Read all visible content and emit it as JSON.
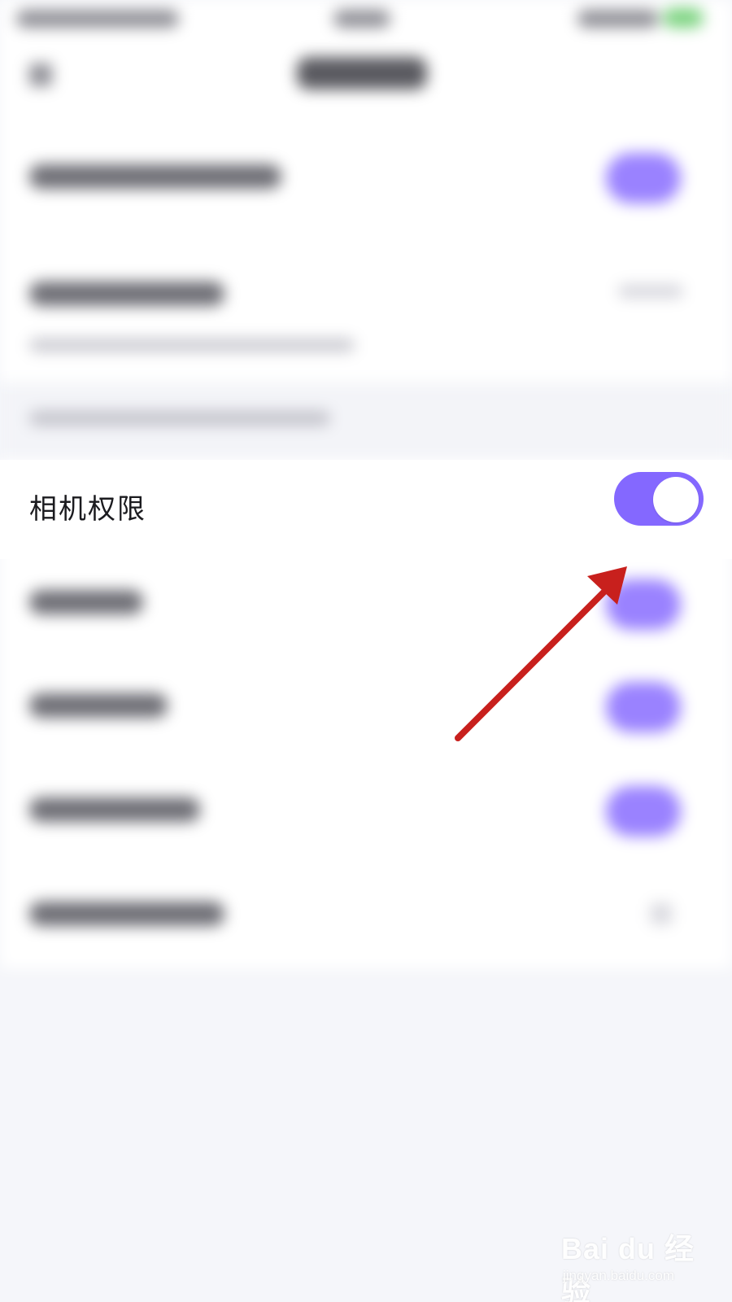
{
  "setting_row": {
    "label": "相机权限",
    "toggle_state": "on"
  },
  "colors": {
    "toggle_on": "#8468ff",
    "annotation_arrow": "#c8201d",
    "page_background": "#f5f6fa"
  },
  "icons": {
    "annotation": "red-arrow-icon",
    "watermark": "baidu-paw-logo"
  },
  "watermark": {
    "logo_text": "Bai du 经验",
    "url": "jingyan.baidu.com"
  }
}
